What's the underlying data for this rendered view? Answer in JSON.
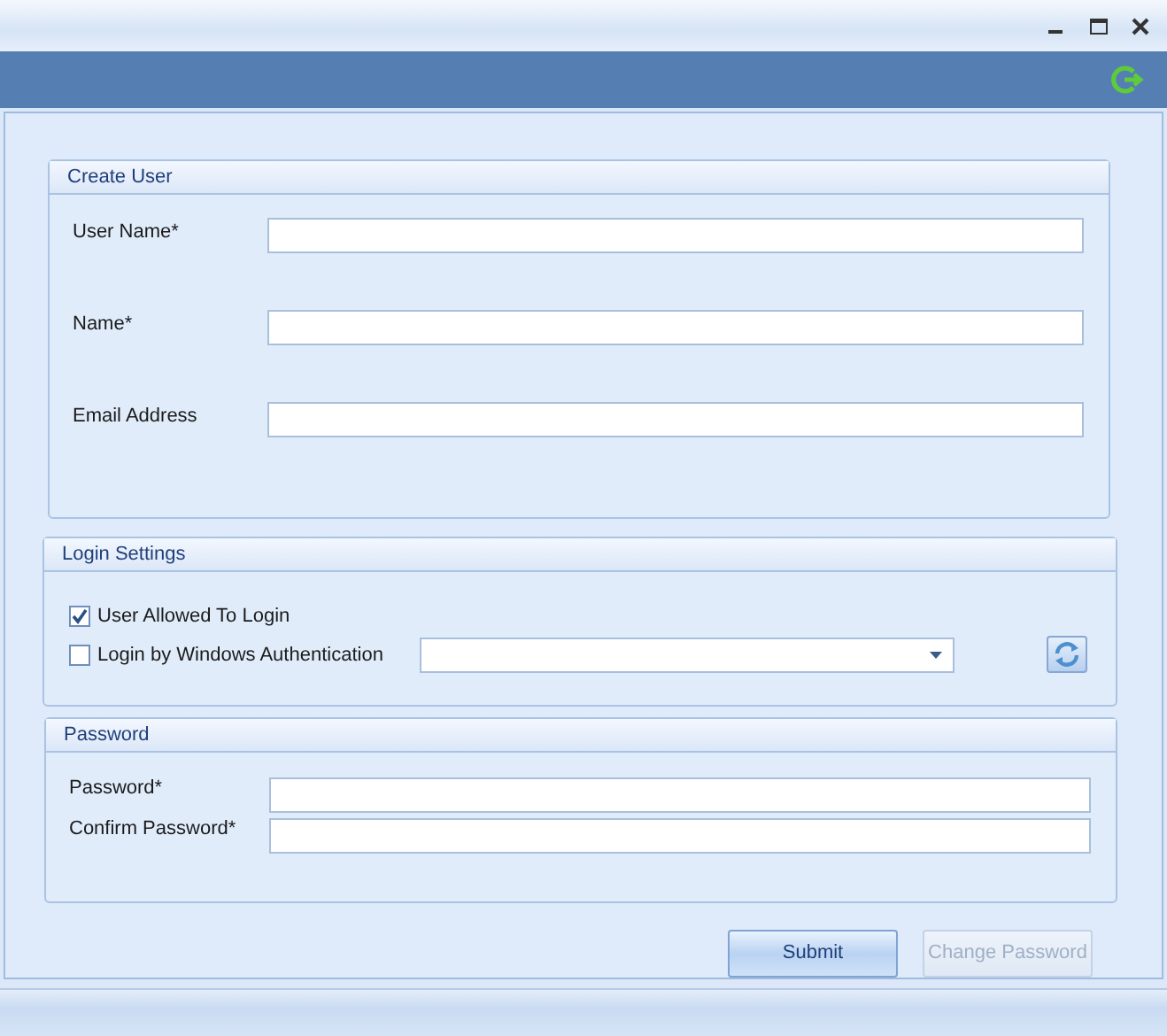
{
  "window": {
    "controls": [
      {
        "kind": "minimize"
      },
      {
        "kind": "maximize"
      },
      {
        "kind": "close"
      }
    ]
  },
  "create_user": {
    "title": "Create User",
    "fields": [
      {
        "label": "User Name*"
      },
      {
        "label": "Name*"
      },
      {
        "label": "Email Address"
      }
    ]
  },
  "login_settings": {
    "title": "Login Settings",
    "allowed": {
      "label": "User Allowed To Login",
      "checked": true
    },
    "windows_auth": {
      "label": "Login by Windows Authentication",
      "checked": false
    }
  },
  "password": {
    "title": "Password",
    "fields": [
      {
        "label": "Password*"
      },
      {
        "label": "Confirm Password*"
      }
    ]
  },
  "buttons": [
    {
      "label": "Submit",
      "disabled": false
    },
    {
      "label": "Change Password",
      "disabled": true
    }
  ]
}
